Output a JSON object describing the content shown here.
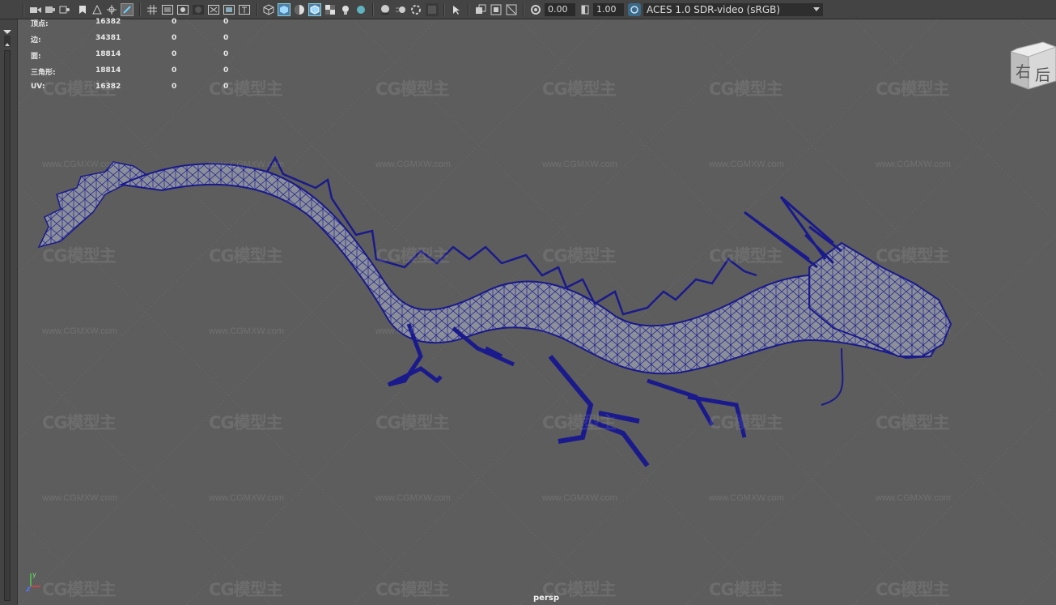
{
  "toolbar": {
    "exposure_value": "0.00",
    "gamma_value": "1.00",
    "color_space": "ACES 1.0 SDR-video (sRGB)",
    "icons": [
      "camera-select-icon",
      "camera-attributes-icon",
      "bookmarks-icon",
      "image-plane-icon",
      "2d-pan-zoom-icon",
      "grease-pencil-icon",
      "grid-icon",
      "film-gate-icon",
      "resolution-gate-icon",
      "gate-mask-icon",
      "field-chart-icon",
      "safe-action-icon",
      "safe-title-icon",
      "wireframe-icon",
      "smooth-shade-icon",
      "use-default-material-icon",
      "wireframe-on-shaded-icon",
      "textured-icon",
      "use-lights-icon",
      "shadows-icon",
      "screen-space-ao-icon",
      "motion-blur-icon",
      "anti-aliasing-icon",
      "depth-of-field-icon",
      "isolate-select-icon",
      "xray-icon",
      "xray-joints-icon",
      "backface-culling-icon",
      "exposure-icon",
      "gamma-icon",
      "color-management-icon"
    ]
  },
  "stats": {
    "rows": [
      {
        "label": "顶点:",
        "v1": "16382",
        "v2": "0",
        "v3": "0"
      },
      {
        "label": "边:",
        "v1": "34381",
        "v2": "0",
        "v3": "0"
      },
      {
        "label": "面:",
        "v1": "18814",
        "v2": "0",
        "v3": "0"
      },
      {
        "label": "三角形:",
        "v1": "18814",
        "v2": "0",
        "v3": "0"
      },
      {
        "label": "UV:",
        "v1": "16382",
        "v2": "0",
        "v3": "0"
      }
    ]
  },
  "viewcube": {
    "face_front": "右",
    "face_side": "后"
  },
  "camera_label": "persp",
  "watermark": {
    "logo": "CG模型主",
    "url": "www.CGMXW.com"
  },
  "colors": {
    "wireframe": "#1a1a8c",
    "mesh": "#8a8f9a",
    "background": "#5d5d5d",
    "toolbar": "#444444"
  }
}
